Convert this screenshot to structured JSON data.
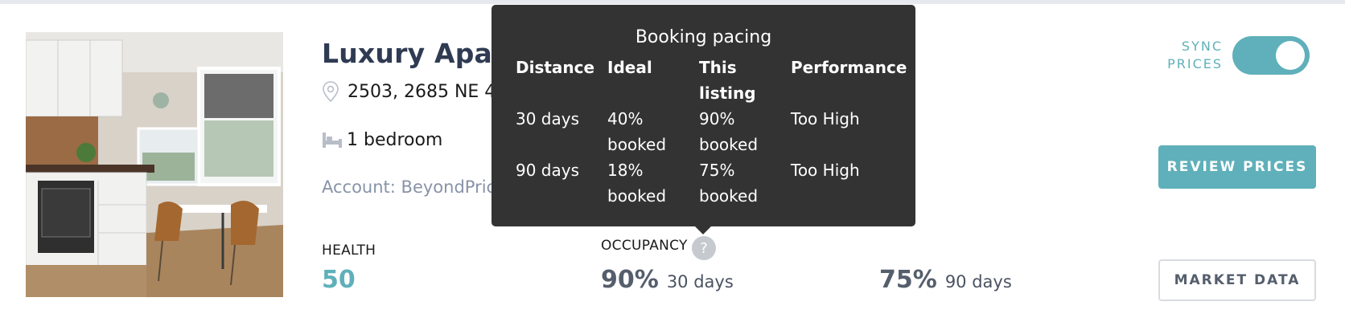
{
  "listing": {
    "title": "Luxury Apartm",
    "address": "2503, 2685 NE 4",
    "bedrooms": "1 bedroom",
    "account": "Account: BeyondPric"
  },
  "stats": {
    "health_label": "HEALTH",
    "health_value": "50",
    "occupancy_label": "OCCUPANCY",
    "occ_30_value": "90%",
    "occ_30_period": "30 days",
    "occ_90_value": "75%",
    "occ_90_period": "90 days",
    "help_glyph": "?"
  },
  "controls": {
    "sync_line1": "SYNC",
    "sync_line2": "PRICES",
    "sync_enabled": true,
    "review_prices": "REVIEW PRICES",
    "market_data": "MARKET DATA"
  },
  "tooltip": {
    "title": "Booking pacing",
    "headers": [
      "Distance",
      "Ideal",
      "This listing",
      "Performance"
    ],
    "rows": [
      [
        "30 days",
        "40% booked",
        "90% booked",
        "Too High"
      ],
      [
        "90 days",
        "18% booked",
        "75% booked",
        "Too High"
      ]
    ]
  },
  "colors": {
    "accent": "#5fb0ba",
    "title": "#2f3b52",
    "tooltip_bg": "#333333"
  },
  "icons": {
    "address": "map-pin-icon",
    "bedrooms": "bed-icon",
    "help": "help-icon"
  }
}
